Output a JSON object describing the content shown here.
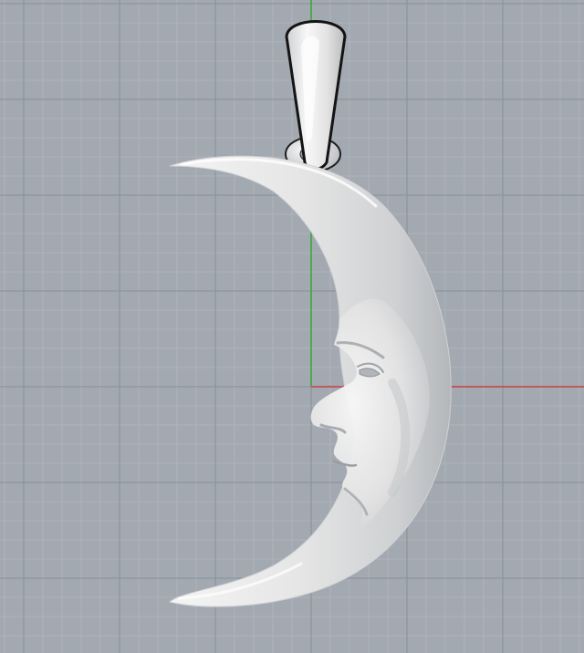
{
  "viewport": {
    "view_type": "front",
    "background_color": "#a3a9b1",
    "minor_grid_color": "#b3b8bf",
    "major_grid_color": "#8e949c",
    "x_axis_color": "#c8413d",
    "y_axis_color": "#3aa83a",
    "model": {
      "name": "crescent-moon-pendant",
      "material_color": "#e8e8e8",
      "shadow_color": "#a9acb0",
      "highlight_color": "#ffffff",
      "outline_color": "#1e1e1e"
    }
  }
}
